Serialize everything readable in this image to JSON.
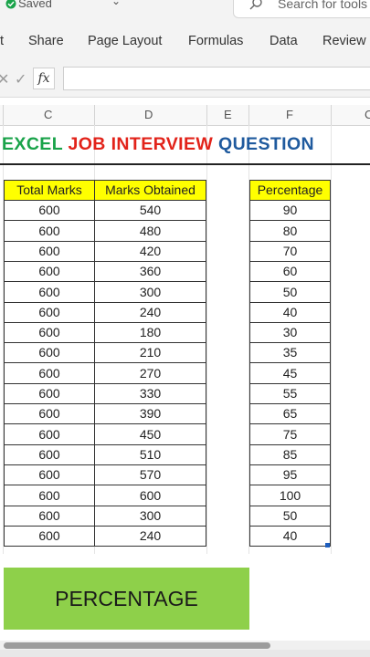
{
  "titlebar": {
    "saved": "Saved",
    "search_placeholder": "Search for tools"
  },
  "ribbon": {
    "tabs": [
      "t",
      "Share",
      "Page Layout",
      "Formulas",
      "Data",
      "Review"
    ]
  },
  "formula_bar": {
    "fx_label": "fx",
    "value": ""
  },
  "columns": [
    "C",
    "D",
    "E",
    "F",
    "C"
  ],
  "heading": {
    "parts": [
      {
        "text": "EXCEL ",
        "color": "#1aa34a"
      },
      {
        "text": "JOB INTERVIEW ",
        "color": "#e2231a"
      },
      {
        "text": "QUESTION",
        "color": "#1f5a9e"
      }
    ]
  },
  "table": {
    "headers": {
      "total": "Total Marks",
      "obtained": "Marks Obtained",
      "percentage": "Percentage"
    },
    "rows": [
      [
        "600",
        "540",
        "90"
      ],
      [
        "600",
        "480",
        "80"
      ],
      [
        "600",
        "420",
        "70"
      ],
      [
        "600",
        "360",
        "60"
      ],
      [
        "600",
        "300",
        "50"
      ],
      [
        "600",
        "240",
        "40"
      ],
      [
        "600",
        "180",
        "30"
      ],
      [
        "600",
        "210",
        "35"
      ],
      [
        "600",
        "270",
        "45"
      ],
      [
        "600",
        "330",
        "55"
      ],
      [
        "600",
        "390",
        "65"
      ],
      [
        "600",
        "450",
        "75"
      ],
      [
        "600",
        "510",
        "85"
      ],
      [
        "600",
        "570",
        "95"
      ],
      [
        "600",
        "600",
        "100"
      ],
      [
        "600",
        "300",
        "50"
      ],
      [
        "600",
        "240",
        "40"
      ]
    ]
  },
  "action": {
    "label": "PERCENTAGE"
  },
  "colors": {
    "header_fill": "#ffff00",
    "button_fill": "#8ed04a"
  }
}
